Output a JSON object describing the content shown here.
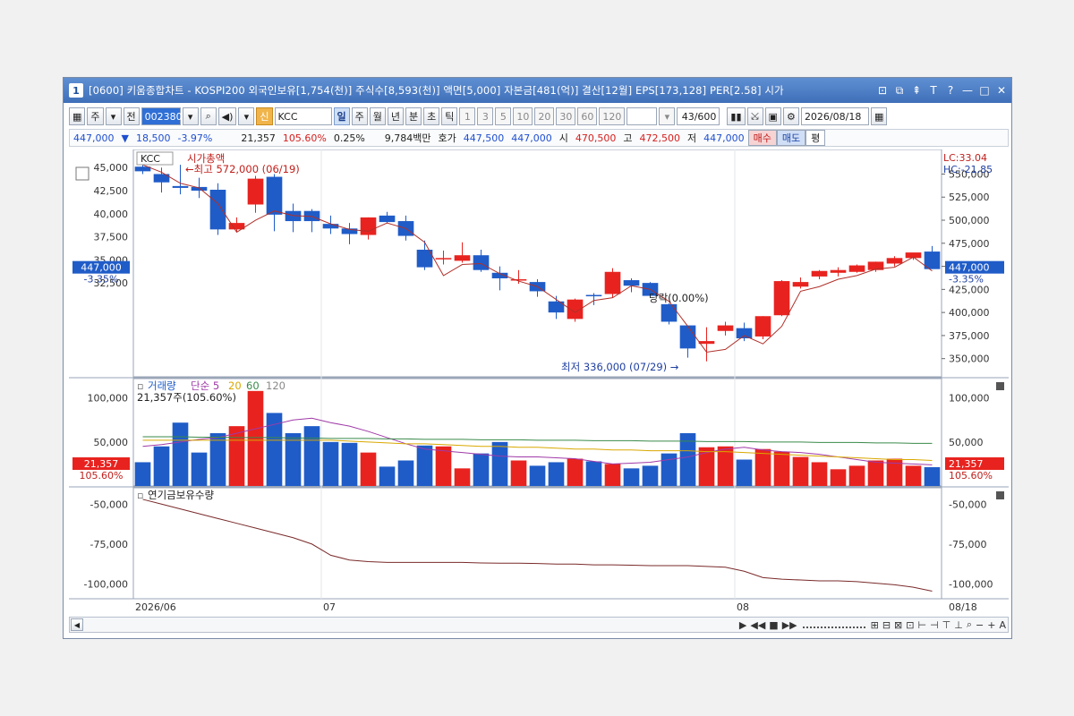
{
  "window": {
    "number": "1",
    "title": "[0600] 키움종합차트 - KOSPI200 외국인보유[1,754(천)] 주식수[8,593(천)] 액면[5,000] 자본금[481(억)] 결산[12월] EPS[173,128] PER[2.58] 시가",
    "controls": [
      "⊡",
      "⧉",
      "⇞",
      "T",
      "?",
      "—",
      "□",
      "✕"
    ]
  },
  "toolbar": {
    "market_label": "주",
    "prev_label": "전",
    "code": "002380",
    "new_badge": "신",
    "name": "KCC",
    "periods": [
      "일",
      "주",
      "월",
      "년",
      "분",
      "초",
      "틱"
    ],
    "intervals": [
      "1",
      "3",
      "5",
      "10",
      "20",
      "30",
      "60",
      "120"
    ],
    "count": "43/600",
    "date": "2026/08/18"
  },
  "quote": {
    "price": "447,000",
    "change": "18,500",
    "change_pct": "-3.97%",
    "volume": "21,357",
    "volume_ratio": "105.60%",
    "turnover": "0.25%",
    "amount": "9,784백만",
    "bid_label": "호가",
    "bid": "447,500",
    "ask": "447,000",
    "open_label": "시",
    "open": "470,500",
    "high_label": "고",
    "high": "472,500",
    "low_label": "저",
    "low": "447,000",
    "buy_label": "매수",
    "sell_label": "매도",
    "avg_label": "평"
  },
  "chart_data": [
    {
      "type": "candlestick",
      "title": "KCC",
      "indicator_label": "시가총액",
      "left_axis_ticks": [
        "45,000",
        "42,500",
        "40,000",
        "37,500",
        "35,000",
        "32,500"
      ],
      "right_axis_ticks": [
        "550,000",
        "525,000",
        "500,000",
        "475,000",
        "450,000",
        "425,000",
        "400,000",
        "375,000",
        "350,000"
      ],
      "ylim": [
        340000,
        565000
      ],
      "lc_label": "LC:33.04",
      "hc_label": "HC:-21.85",
      "left_price_tag": "447,000",
      "left_pct_tag": "-3.35%",
      "right_price_tag": "447,000",
      "right_pct_tag": "-3.35%",
      "annotations": {
        "high": "최고 572,000 (06/19)",
        "low": "최저 336,000 (07/29)",
        "limit": "당락(0.00%)"
      },
      "candles": [
        {
          "o": 558000,
          "h": 563000,
          "l": 550000,
          "c": 553000
        },
        {
          "o": 550000,
          "h": 557000,
          "l": 530000,
          "c": 541000
        },
        {
          "o": 537000,
          "h": 560000,
          "l": 528000,
          "c": 535000
        },
        {
          "o": 536000,
          "h": 546000,
          "l": 524000,
          "c": 532000
        },
        {
          "o": 533000,
          "h": 540000,
          "l": 484000,
          "c": 490000
        },
        {
          "o": 490000,
          "h": 503000,
          "l": 487000,
          "c": 497000
        },
        {
          "o": 517000,
          "h": 548000,
          "l": 508000,
          "c": 545000
        },
        {
          "o": 547000,
          "h": 550000,
          "l": 488000,
          "c": 506000
        },
        {
          "o": 510000,
          "h": 518000,
          "l": 487000,
          "c": 499000
        },
        {
          "o": 510000,
          "h": 512000,
          "l": 487000,
          "c": 499000
        },
        {
          "o": 496000,
          "h": 505000,
          "l": 485000,
          "c": 491000
        },
        {
          "o": 491000,
          "h": 497000,
          "l": 474000,
          "c": 485000
        },
        {
          "o": 484000,
          "h": 503000,
          "l": 479000,
          "c": 503000
        },
        {
          "o": 505000,
          "h": 509000,
          "l": 497000,
          "c": 498000
        },
        {
          "o": 499000,
          "h": 505000,
          "l": 478000,
          "c": 483000
        },
        {
          "o": 468000,
          "h": 478000,
          "l": 446000,
          "c": 449000
        },
        {
          "o": 458000,
          "h": 467000,
          "l": 452000,
          "c": 459000
        },
        {
          "o": 456000,
          "h": 476000,
          "l": 454000,
          "c": 462000
        },
        {
          "o": 462000,
          "h": 468000,
          "l": 444000,
          "c": 446000
        },
        {
          "o": 443000,
          "h": 450000,
          "l": 424000,
          "c": 437000
        },
        {
          "o": 436000,
          "h": 446000,
          "l": 431000,
          "c": 436000
        },
        {
          "o": 433000,
          "h": 436000,
          "l": 417000,
          "c": 423000
        },
        {
          "o": 412000,
          "h": 418000,
          "l": 393000,
          "c": 400000
        },
        {
          "o": 393000,
          "h": 415000,
          "l": 390000,
          "c": 414000
        },
        {
          "o": 419000,
          "h": 421000,
          "l": 408000,
          "c": 418000
        },
        {
          "o": 420000,
          "h": 448000,
          "l": 416000,
          "c": 444000
        },
        {
          "o": 435000,
          "h": 437000,
          "l": 422000,
          "c": 429000
        },
        {
          "o": 432000,
          "h": 433000,
          "l": 418000,
          "c": 418000
        },
        {
          "o": 409000,
          "h": 410000,
          "l": 387000,
          "c": 390000
        },
        {
          "o": 386000,
          "h": 386000,
          "l": 351000,
          "c": 361000
        },
        {
          "o": 366000,
          "h": 384000,
          "l": 347000,
          "c": 369000
        },
        {
          "o": 380000,
          "h": 390000,
          "l": 375000,
          "c": 386000
        },
        {
          "o": 383000,
          "h": 389000,
          "l": 369000,
          "c": 372000
        },
        {
          "o": 374000,
          "h": 396000,
          "l": 371000,
          "c": 396000
        },
        {
          "o": 397000,
          "h": 435000,
          "l": 396000,
          "c": 434000
        },
        {
          "o": 428000,
          "h": 438000,
          "l": 426000,
          "c": 433000
        },
        {
          "o": 439000,
          "h": 446000,
          "l": 436000,
          "c": 445000
        },
        {
          "o": 443000,
          "h": 449000,
          "l": 439000,
          "c": 446000
        },
        {
          "o": 444000,
          "h": 452000,
          "l": 443000,
          "c": 451000
        },
        {
          "o": 446000,
          "h": 455000,
          "l": 444000,
          "c": 455000
        },
        {
          "o": 453000,
          "h": 461000,
          "l": 450000,
          "c": 459000
        },
        {
          "o": 459000,
          "h": 464000,
          "l": 457000,
          "c": 465000
        },
        {
          "o": 466000,
          "h": 472000,
          "l": 447000,
          "c": 447000
        }
      ],
      "ma": [
        560000,
        552000,
        540000,
        535000,
        518000,
        487000,
        500000,
        510000,
        505000,
        504000,
        496000,
        490000,
        488000,
        497000,
        491000,
        476000,
        440000,
        452000,
        453000,
        442000,
        434000,
        428000,
        414000,
        400000,
        413000,
        416000,
        429000,
        425000,
        412000,
        385000,
        357000,
        360000,
        375000,
        366000,
        385000,
        423000,
        428000,
        436000,
        440000,
        447000,
        449000,
        460000,
        445000
      ]
    },
    {
      "type": "bar",
      "title": "거래량",
      "ma_labels": [
        "단순 5",
        "20",
        "60",
        "120"
      ],
      "ma_colors": [
        "#a03aa8",
        "#d9a800",
        "#3a8a4a",
        "#888888"
      ],
      "current_label": "21,357주(105.60%)",
      "left_axis_ticks": [
        "100,000",
        "50,000"
      ],
      "right_axis_ticks": [
        "100,000",
        "50,000"
      ],
      "ylim": [
        0,
        118000
      ],
      "left_value_tag": "21,357",
      "left_pct_tag": "105.60%",
      "right_value_tag": "21,357",
      "right_pct_tag": "105.60%",
      "values": [
        27000,
        45000,
        72000,
        38000,
        60000,
        68000,
        108000,
        83000,
        60000,
        68000,
        50000,
        49000,
        38000,
        22000,
        29000,
        46000,
        45000,
        20000,
        37000,
        50000,
        29000,
        23000,
        27000,
        31000,
        28000,
        25000,
        20000,
        23000,
        37000,
        60000,
        44000,
        45000,
        30000,
        42000,
        39000,
        33000,
        27000,
        19000,
        23000,
        29000,
        31000,
        23000,
        21357
      ],
      "ma5": [
        45000,
        47000,
        50000,
        53000,
        55000,
        60000,
        65000,
        70000,
        75000,
        77000,
        72000,
        68000,
        62000,
        55000,
        48000,
        42000,
        40000,
        38000,
        36000,
        34000,
        33000,
        33000,
        32000,
        31000,
        28000,
        25000,
        26000,
        27000,
        30000,
        33000,
        38000,
        42000,
        44000,
        41000,
        39000,
        38000,
        36000,
        33000,
        30000,
        27000,
        26000,
        25000,
        24000
      ],
      "ma20": [
        52000,
        52000,
        52000,
        52000,
        52000,
        52000,
        52000,
        52000,
        52000,
        52000,
        52000,
        51000,
        50000,
        49000,
        48000,
        48000,
        47000,
        46000,
        45000,
        45000,
        44000,
        44000,
        43000,
        42000,
        42000,
        41000,
        41000,
        40000,
        40000,
        40000,
        39000,
        39000,
        38000,
        37000,
        36000,
        35000,
        34000,
        33000,
        32000,
        31000,
        30000,
        30000,
        29000
      ],
      "ma60": [
        56000,
        56000,
        56000,
        55500,
        55500,
        55000,
        55000,
        55000,
        54500,
        54500,
        54000,
        54000,
        54000,
        53500,
        53500,
        53000,
        53000,
        53000,
        52500,
        52500,
        52500,
        52000,
        52000,
        52000,
        51500,
        51500,
        51500,
        51000,
        51000,
        51000,
        50500,
        50500,
        50500,
        50000,
        50000,
        50000,
        49500,
        49500,
        49500,
        49000,
        49000,
        48500,
        48500
      ]
    },
    {
      "type": "line",
      "title": "연기금보유수량",
      "left_axis_ticks": [
        "-50,000",
        "-75,000",
        "-100,000"
      ],
      "right_axis_ticks": [
        "-50,000",
        "-75,000",
        "-100,000"
      ],
      "ylim": [
        -107000,
        -42000
      ],
      "x_labels": [
        "2026/06",
        "07",
        "08",
        "08/18"
      ],
      "values": [
        -47000,
        -50000,
        -53000,
        -56000,
        -59000,
        -62000,
        -65000,
        -68000,
        -71000,
        -75000,
        -82000,
        -85000,
        -86000,
        -86500,
        -86500,
        -86500,
        -86500,
        -86500,
        -86800,
        -87000,
        -87000,
        -87200,
        -87500,
        -87500,
        -88000,
        -88000,
        -88200,
        -88500,
        -88500,
        -88500,
        -89000,
        -89500,
        -92000,
        -96000,
        -97000,
        -97500,
        -98000,
        -98000,
        -98500,
        -99500,
        -100500,
        -102000,
        -104500
      ]
    }
  ],
  "scrollbar": {
    "icons": [
      "▶",
      "◀◀",
      "■",
      "▶▶",
      "⊞",
      "⊟",
      "⊠",
      "⊡",
      "⊢",
      "⊣",
      "⊤",
      "⊥",
      "⌕",
      "−",
      "+",
      "A"
    ]
  }
}
